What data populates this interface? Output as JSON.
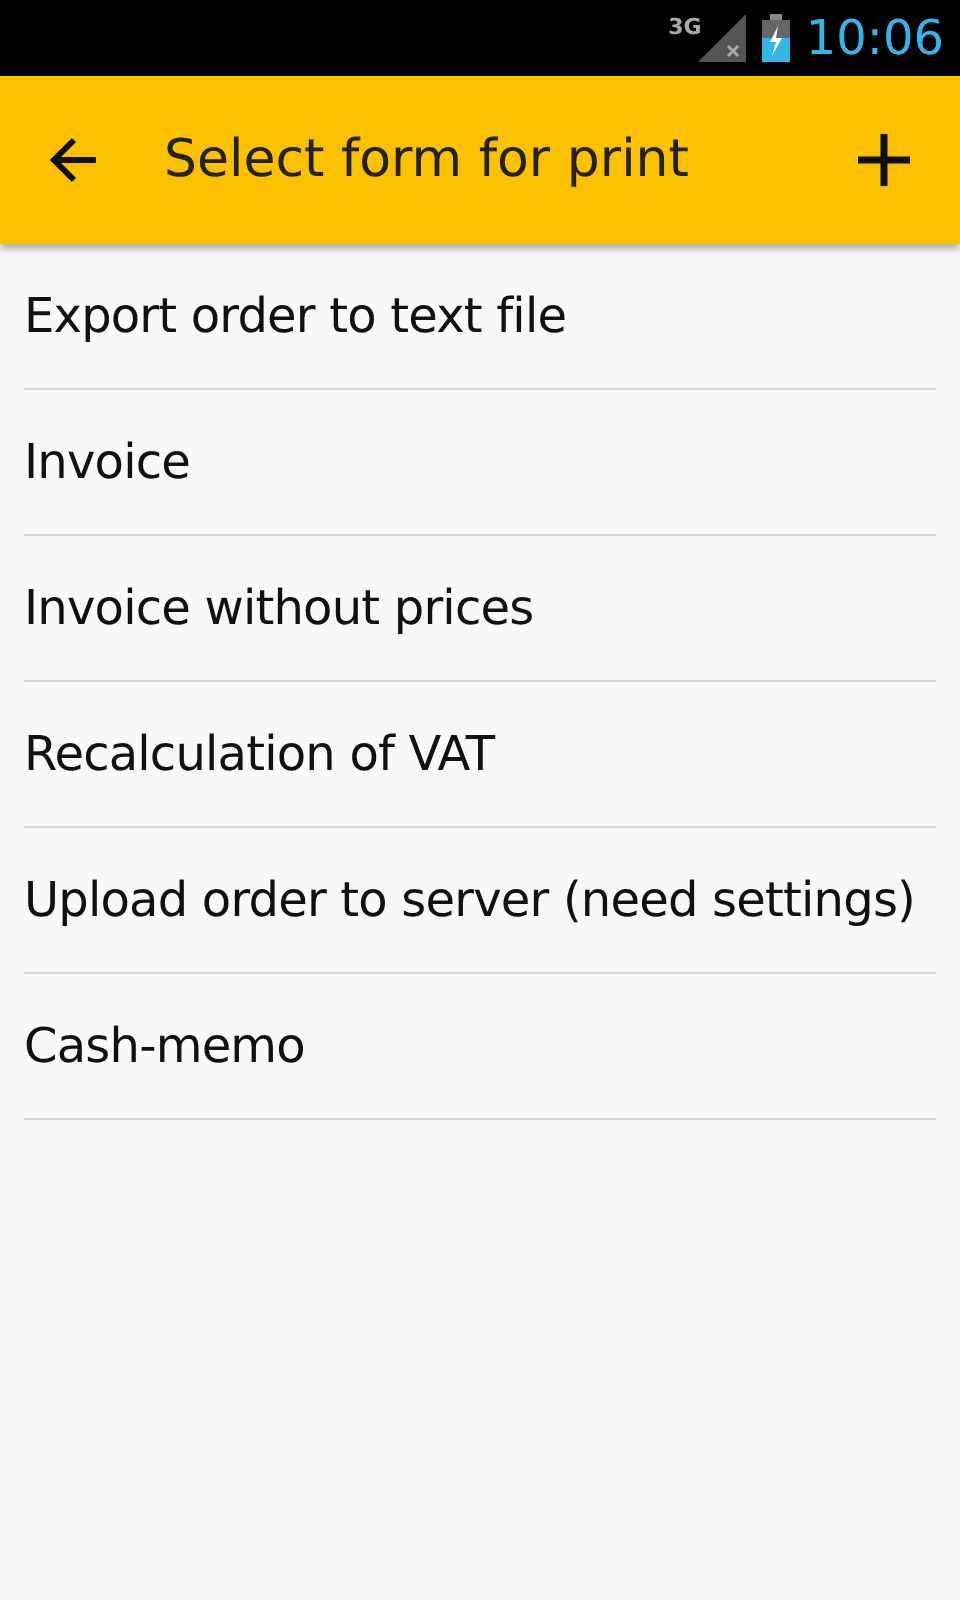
{
  "status_bar": {
    "network": "3G",
    "time": "10:06"
  },
  "toolbar": {
    "title": "Select form for print"
  },
  "forms": [
    {
      "label": "Export order to text file"
    },
    {
      "label": "Invoice"
    },
    {
      "label": "Invoice without prices"
    },
    {
      "label": "Recalculation of VAT"
    },
    {
      "label": "Upload order to server (need settings)"
    },
    {
      "label": "Cash-memo"
    }
  ]
}
